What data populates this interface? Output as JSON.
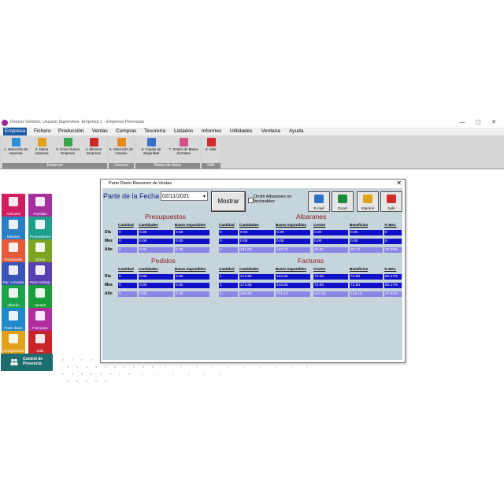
{
  "window": {
    "title": "Dsocar Gestión. Usuario Supervisor. Empresa 1 - Empresa Peninsula",
    "minimize": "—",
    "maximize": "▢",
    "close": "✕"
  },
  "menu": [
    {
      "label": "Empresa",
      "active": true
    },
    {
      "label": "Fichero"
    },
    {
      "label": "Producción"
    },
    {
      "label": "Ventas"
    },
    {
      "label": "Compras"
    },
    {
      "label": "Tesorería"
    },
    {
      "label": "Listados"
    },
    {
      "label": "Informes"
    },
    {
      "label": "Utilidades"
    },
    {
      "label": "Ventana"
    },
    {
      "label": "Ayuda"
    }
  ],
  "ribbon": {
    "groups": [
      {
        "label": "Empresa",
        "buttons": [
          {
            "label": "1. Selección de empresa",
            "icon": "home-icon",
            "color": "#2e8fd6"
          },
          {
            "label": "2. Datos empresa",
            "icon": "edit-icon",
            "color": "#e0a11b"
          },
          {
            "label": "3. Crear Nueva Empresa",
            "icon": "new-window-icon",
            "color": "#3aa64a"
          },
          {
            "label": "4. Eliminar Empresa",
            "icon": "delete-icon",
            "color": "#c82a2a"
          }
        ]
      },
      {
        "label": "Usuario",
        "buttons": [
          {
            "label": "5. Selección de Usuario",
            "icon": "users-icon",
            "color": "#e58a1f"
          }
        ]
      },
      {
        "label": "Bases de datos",
        "buttons": [
          {
            "label": "6. Copias de Seguridad",
            "icon": "lock-icon",
            "color": "#3a6fc8"
          },
          {
            "label": "7. Gestor de Bases de Datos",
            "icon": "clock-icon",
            "color": "#d4508c"
          }
        ]
      },
      {
        "label": "Salir",
        "buttons": [
          {
            "label": "8. Salir",
            "icon": "exit-icon",
            "color": "#d02a2a"
          }
        ]
      }
    ]
  },
  "tiles": [
    {
      "label": "Artículos",
      "color": "#d11e63",
      "icon": "grid-icon"
    },
    {
      "label": "Familias",
      "color": "#a62f9f",
      "icon": "tree-icon"
    },
    {
      "label": "Clientes",
      "color": "#2a7fc4",
      "icon": "users-icon"
    },
    {
      "label": "Proveedores",
      "color": "#1e9e8c",
      "icon": "truck-icon"
    },
    {
      "label": "Empleados",
      "color": "#e55a3a",
      "icon": "employee-icon"
    },
    {
      "label": "Obras",
      "color": "#7ba31f",
      "icon": "tools-icon"
    },
    {
      "label": "Par. consulta",
      "color": "#3a55b8",
      "icon": "star-icon"
    },
    {
      "label": "Parte trabajo",
      "color": "#5a3fb0",
      "icon": "clipboard-icon"
    },
    {
      "label": "Albarán",
      "color": "#1aa34a",
      "icon": "document-a-icon"
    },
    {
      "label": "Ventas",
      "color": "#1a9e3a",
      "icon": "document-f-icon"
    },
    {
      "label": "Parte diario",
      "color": "#1e88c8",
      "icon": "pie-chart-icon"
    },
    {
      "label": "Formatos",
      "color": "#b12e9e",
      "icon": "printer-icon"
    },
    {
      "label": "Configuración",
      "color": "#e0a11b",
      "icon": "gears-icon"
    },
    {
      "label": "Salir",
      "color": "#c8242a",
      "icon": "exit-icon"
    }
  ],
  "control_presencia": {
    "label": "Control de Presencia",
    "color": "#1e6d6e"
  },
  "dialog": {
    "title": "Parte Diario Resumen de Ventas",
    "close": "✕",
    "fecha_label": "Parte de la Fecha",
    "fecha_value": "02/11/2021",
    "mostrar": "Mostrar",
    "omitir_label": "Omitir Albaranes no facturables",
    "tool_buttons": [
      {
        "label": "E-mail",
        "icon": "email-icon",
        "color": "#2e6fc8"
      },
      {
        "label": "Excel",
        "icon": "excel-icon",
        "color": "#1f8a3a"
      },
      {
        "label": "Imprimir",
        "icon": "printer-icon",
        "color": "#e0a11b"
      },
      {
        "label": "Salir",
        "icon": "exit-icon",
        "color": "#d02a2a"
      }
    ],
    "row_labels": [
      "Día",
      "Mes",
      "Año"
    ],
    "presupuestos": {
      "title": "Presupuestos",
      "headers": [
        "Cantidad",
        "Cantidades",
        "Bases Imponibles"
      ],
      "rows": [
        [
          "0",
          "0.00",
          "0.00"
        ],
        [
          "0",
          "0.00",
          "0.00"
        ],
        [
          "0",
          "0.00",
          "0.00"
        ]
      ]
    },
    "albaranes": {
      "title": "Albaranes",
      "headers": [
        "Cantidad",
        "Cantidades",
        "Bases Imponibles",
        "Costes",
        "Beneficios",
        "% Ben."
      ],
      "rows": [
        [
          "0",
          "0.00",
          "0.00",
          "0.00",
          "0.00",
          "0"
        ],
        [
          "0",
          "0.00",
          "0.00",
          "0.00",
          "0.00",
          "0"
        ],
        [
          "4",
          "181.00",
          "133.72",
          "40.00",
          "93.72",
          "70.09%"
        ]
      ]
    },
    "pedidos": {
      "title": "Pedidos",
      "headers": [
        "Cantidad",
        "Cantidades",
        "Bases Imponibles"
      ],
      "rows": [
        [
          "0",
          "0.00",
          "0.00"
        ],
        [
          "0",
          "0.00",
          "0.00"
        ],
        [
          "0",
          "0.00",
          "0.00"
        ]
      ]
    },
    "facturas": {
      "title": "Facturas",
      "headers": [
        "Cantidad",
        "Cantidades",
        "Bases Imponibles",
        "Costes",
        "Beneficios",
        "% Ben."
      ],
      "rows": [
        [
          "1",
          "174.85",
          "144.50",
          "72.00",
          "72.50",
          "50.17%"
        ],
        [
          "1",
          "174.85",
          "144.50",
          "72.00",
          "72.50",
          "50.17%"
        ],
        [
          "4",
          "320.65",
          "271.10",
          "142.00",
          "129.10",
          "47.62%"
        ]
      ]
    }
  }
}
